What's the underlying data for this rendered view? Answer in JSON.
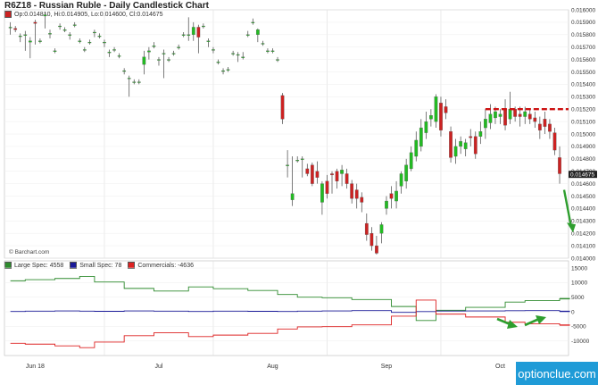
{
  "title": "R6Z18 - Russian Ruble - Daily Candlestick Chart",
  "ohlc_label": "Op:0.014810, Hi:0.014905, Lo:0.014600, Cl:0.014675",
  "copyright": "© Barchart.com",
  "watermark": "optionclue.com",
  "colors": {
    "up": "#22bb22",
    "down": "#cc2222",
    "large_spec": "#2e8b2e",
    "small_spec": "#1a1a99",
    "commercials": "#dd2222",
    "annotation": "#cc1111",
    "arrow": "#2e9e2e"
  },
  "chart_data": [
    {
      "type": "candlestick",
      "ylim": [
        0.014,
        0.016
      ],
      "yticks": [
        "0.016000",
        "0.015900",
        "0.015800",
        "0.015700",
        "0.015600",
        "0.015500",
        "0.015400",
        "0.015300",
        "0.015200",
        "0.015100",
        "0.015000",
        "0.014900",
        "0.014800",
        "0.014700",
        "0.014600",
        "0.014500",
        "0.014400",
        "0.014300",
        "0.014200",
        "0.014100",
        "0.014000"
      ],
      "ytick_values": [
        0.016,
        0.0159,
        0.0158,
        0.0157,
        0.0156,
        0.0155,
        0.0154,
        0.0153,
        0.0152,
        0.0151,
        0.015,
        0.0149,
        0.0148,
        0.0147,
        0.0146,
        0.0145,
        0.0144,
        0.0143,
        0.0142,
        0.0141,
        0.014
      ],
      "candles": [
        [
          0.01586,
          0.0159,
          0.0158,
          0.01586
        ],
        [
          0.01585,
          0.01587,
          0.01582,
          0.01584
        ],
        [
          0.01579,
          0.01581,
          0.01574,
          0.01579
        ],
        [
          0.0158,
          0.01583,
          0.01567,
          0.0158
        ],
        [
          0.01574,
          0.01578,
          0.01561,
          0.01575
        ],
        [
          0.0159,
          0.01592,
          0.01572,
          0.01589
        ],
        [
          0.01575,
          0.01577,
          0.01573,
          0.01575
        ],
        [
          0.01595,
          0.01598,
          0.01585,
          0.01596
        ],
        [
          0.01581,
          0.01584,
          0.01577,
          0.01581
        ],
        [
          0.01567,
          0.01569,
          0.01565,
          0.01567
        ],
        [
          0.01587,
          0.01589,
          0.01584,
          0.01587
        ],
        [
          0.01584,
          0.01586,
          0.01582,
          0.01584
        ],
        [
          0.0158,
          0.01582,
          0.01576,
          0.0158
        ],
        [
          0.01588,
          0.0159,
          0.01586,
          0.01588
        ],
        [
          0.01575,
          0.01577,
          0.01573,
          0.01575
        ],
        [
          0.01568,
          0.0157,
          0.01566,
          0.01568
        ],
        [
          0.01574,
          0.01576,
          0.01572,
          0.01574
        ],
        [
          0.01582,
          0.01584,
          0.01578,
          0.01582
        ],
        [
          0.01579,
          0.01581,
          0.01577,
          0.01579
        ],
        [
          0.01574,
          0.01576,
          0.0157,
          0.01574
        ],
        [
          0.01566,
          0.01568,
          0.01562,
          0.01566
        ],
        [
          0.01568,
          0.0157,
          0.01566,
          0.01568
        ],
        [
          0.01563,
          0.01565,
          0.01561,
          0.01563
        ],
        [
          0.01551,
          0.01553,
          0.01548,
          0.01551
        ],
        [
          0.01545,
          0.01547,
          0.0153,
          0.01545
        ],
        [
          0.01542,
          0.01544,
          0.0154,
          0.01542
        ],
        [
          0.01542,
          0.01544,
          0.0154,
          0.01542
        ],
        [
          0.01556,
          0.01567,
          0.01548,
          0.01562
        ],
        [
          0.01566,
          0.0157,
          0.0156,
          0.01567
        ],
        [
          0.01571,
          0.01574,
          0.01569,
          0.01571
        ],
        [
          0.0156,
          0.01562,
          0.01555,
          0.0156
        ],
        [
          0.01565,
          0.01568,
          0.01545,
          0.01565
        ],
        [
          0.0156,
          0.01562,
          0.01558,
          0.0156
        ],
        [
          0.01565,
          0.01567,
          0.01563,
          0.01565
        ],
        [
          0.0157,
          0.01572,
          0.01568,
          0.0157
        ],
        [
          0.0158,
          0.01582,
          0.01578,
          0.0158
        ],
        [
          0.0158,
          0.01594,
          0.01575,
          0.0158
        ],
        [
          0.0158,
          0.0159,
          0.01575,
          0.01586
        ],
        [
          0.01586,
          0.01588,
          0.01565,
          0.01578
        ],
        [
          0.01587,
          0.01589,
          0.01585,
          0.01587
        ],
        [
          0.01575,
          0.01577,
          0.0157,
          0.01575
        ],
        [
          0.01568,
          0.0157,
          0.01565,
          0.01568
        ],
        [
          0.01558,
          0.0156,
          0.01556,
          0.01558
        ],
        [
          0.01551,
          0.01553,
          0.01548,
          0.01551
        ],
        [
          0.01552,
          0.01554,
          0.0155,
          0.01552
        ],
        [
          0.01565,
          0.01567,
          0.01563,
          0.01565
        ],
        [
          0.01564,
          0.01566,
          0.01558,
          0.01564
        ],
        [
          0.01562,
          0.01566,
          0.0156,
          0.01562
        ],
        [
          0.0158,
          0.01583,
          0.01578,
          0.0158
        ],
        [
          0.0159,
          0.01593,
          0.01588,
          0.0159
        ],
        [
          0.0158,
          0.01585,
          0.01574,
          0.01584
        ],
        [
          0.01573,
          0.01575,
          0.01571,
          0.01573
        ],
        [
          0.01567,
          0.01569,
          0.01565,
          0.01567
        ],
        [
          0.01567,
          0.01569,
          0.01565,
          0.01567
        ],
        [
          0.0156,
          0.01562,
          0.01558,
          0.0156
        ],
        [
          0.01531,
          0.01533,
          0.01508,
          0.01512
        ],
        [
          0.01475,
          0.01487,
          0.01465,
          0.01475
        ],
        [
          0.01447,
          0.01482,
          0.01442,
          0.01452
        ],
        [
          0.01479,
          0.01482,
          0.01477,
          0.01479
        ],
        [
          0.0148,
          0.01482,
          0.01465,
          0.0148
        ],
        [
          0.01472,
          0.01476,
          0.01466,
          0.01468
        ],
        [
          0.01475,
          0.01477,
          0.01458,
          0.0146
        ],
        [
          0.0147,
          0.01478,
          0.0146,
          0.01465
        ],
        [
          0.01445,
          0.01462,
          0.01435,
          0.0146
        ],
        [
          0.01462,
          0.01467,
          0.01448,
          0.01452
        ],
        [
          0.01468,
          0.0147,
          0.01452,
          0.01467
        ],
        [
          0.0147,
          0.01472,
          0.01456,
          0.01462
        ],
        [
          0.01468,
          0.01475,
          0.01458,
          0.01471
        ],
        [
          0.01468,
          0.01472,
          0.01456,
          0.0146
        ],
        [
          0.0146,
          0.01463,
          0.01444,
          0.01448
        ],
        [
          0.01455,
          0.0146,
          0.0144,
          0.01448
        ],
        [
          0.01449,
          0.01453,
          0.01437,
          0.01445
        ],
        [
          0.01428,
          0.01436,
          0.01414,
          0.01419
        ],
        [
          0.0142,
          0.01425,
          0.01406,
          0.0141
        ],
        [
          0.0141,
          0.01418,
          0.01403,
          0.01404
        ],
        [
          0.0142,
          0.01429,
          0.01412,
          0.01427
        ],
        [
          0.0144,
          0.0145,
          0.01435,
          0.01446
        ],
        [
          0.01452,
          0.01458,
          0.0144,
          0.01448
        ],
        [
          0.01446,
          0.01462,
          0.0144,
          0.01454
        ],
        [
          0.01458,
          0.0147,
          0.01452,
          0.01468
        ],
        [
          0.01462,
          0.0148,
          0.01456,
          0.01475
        ],
        [
          0.01472,
          0.0149,
          0.0147,
          0.01485
        ],
        [
          0.01482,
          0.01502,
          0.01478,
          0.01495
        ],
        [
          0.0149,
          0.01512,
          0.01486,
          0.01505
        ],
        [
          0.01501,
          0.01518,
          0.01496,
          0.0151
        ],
        [
          0.01512,
          0.0152,
          0.01506,
          0.01515
        ],
        [
          0.0151,
          0.01532,
          0.01505,
          0.0153
        ],
        [
          0.01525,
          0.0153,
          0.01498,
          0.01503
        ],
        [
          0.01522,
          0.01528,
          0.01512,
          0.01517
        ],
        [
          0.01502,
          0.01506,
          0.01477,
          0.01481
        ],
        [
          0.01482,
          0.01496,
          0.01476,
          0.0149
        ],
        [
          0.0149,
          0.01498,
          0.01484,
          0.01494
        ],
        [
          0.01488,
          0.01496,
          0.01482,
          0.01493
        ],
        [
          0.01498,
          0.01504,
          0.0149,
          0.01497
        ],
        [
          0.01498,
          0.01502,
          0.0148,
          0.01484
        ],
        [
          0.01498,
          0.0151,
          0.01492,
          0.01502
        ],
        [
          0.01505,
          0.0152,
          0.01496,
          0.01512
        ],
        [
          0.01509,
          0.01524,
          0.01504,
          0.01516
        ],
        [
          0.01513,
          0.01522,
          0.01508,
          0.01518
        ],
        [
          0.01514,
          0.0152,
          0.01508,
          0.01516
        ],
        [
          0.0152,
          0.01528,
          0.01503,
          0.01507
        ],
        [
          0.01512,
          0.01534,
          0.01508,
          0.0152
        ],
        [
          0.0152,
          0.01522,
          0.0151,
          0.01514
        ],
        [
          0.01516,
          0.01522,
          0.01506,
          0.01514
        ],
        [
          0.01514,
          0.01522,
          0.01508,
          0.01518
        ],
        [
          0.01516,
          0.0152,
          0.01508,
          0.01512
        ],
        [
          0.01513,
          0.01518,
          0.01505,
          0.0151
        ],
        [
          0.01508,
          0.01514,
          0.01496,
          0.01503
        ],
        [
          0.01512,
          0.01518,
          0.015,
          0.01506
        ],
        [
          0.01508,
          0.01512,
          0.01496,
          0.01502
        ],
        [
          0.01501,
          0.01505,
          0.01483,
          0.01487
        ],
        [
          0.01481,
          0.0149,
          0.0146,
          0.01468
        ]
      ],
      "annotations": {
        "resistance_level": 0.0152,
        "last_price_label": "0.014675",
        "last_price": 0.014675
      },
      "xlabels": [
        "Jun 18",
        "Jul",
        "Aug",
        "Sep",
        "Oct"
      ]
    },
    {
      "type": "line",
      "ylim": [
        -15000,
        15000
      ],
      "yticks": [
        "15000",
        "10000",
        "5000",
        "0",
        "-5000",
        "-10000"
      ],
      "ytick_values": [
        15000,
        10000,
        5000,
        0,
        -5000,
        -10000
      ],
      "x": [
        0,
        3,
        9,
        14,
        17,
        23,
        29,
        36,
        41,
        48,
        54,
        58,
        63,
        69,
        77,
        82,
        86,
        92,
        100,
        104,
        111,
        113
      ],
      "series": [
        {
          "name": "Large Spec",
          "legend": "Large Spec: 4558",
          "values": [
            10600,
            11000,
            11400,
            12100,
            10200,
            8000,
            7100,
            8500,
            7900,
            7300,
            5900,
            5000,
            4800,
            4200,
            1800,
            -3000,
            500,
            1500,
            3300,
            3800,
            4400,
            4558
          ]
        },
        {
          "name": "Small Spec",
          "legend": "Small Spec: 78",
          "values": [
            100,
            200,
            300,
            200,
            150,
            300,
            200,
            100,
            200,
            150,
            100,
            200,
            300,
            400,
            -200,
            50,
            250,
            300,
            350,
            400,
            200,
            78
          ]
        },
        {
          "name": "Commercials",
          "legend": "Commercials: -4636",
          "values": [
            -10800,
            -11100,
            -11700,
            -12300,
            -10400,
            -8200,
            -7200,
            -8500,
            -8000,
            -7400,
            -5900,
            -5200,
            -5100,
            -4500,
            -1500,
            4000,
            -800,
            -1800,
            -3600,
            -4100,
            -4500,
            -4636
          ]
        }
      ],
      "xlabels": [
        "Jun 18",
        "Jul",
        "Aug",
        "Sep",
        "Oct"
      ]
    }
  ]
}
